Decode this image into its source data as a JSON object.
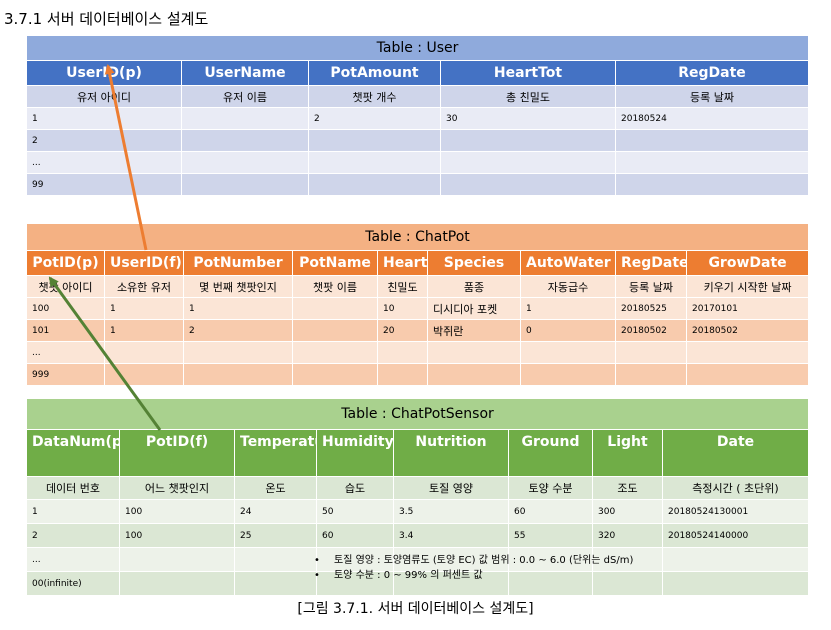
{
  "heading": "3.7.1 서버 데이터베이스 설계도",
  "user_table": {
    "title": "Table : User",
    "columns": [
      "UserID(p)",
      "UserName",
      "PotAmount",
      "HeartTot",
      "RegDate"
    ],
    "descriptions": [
      "유저 아이디",
      "유저 이름",
      "챗팟 개수",
      "총 친밀도",
      "등록 날짜"
    ],
    "rows": [
      [
        "1",
        "",
        "2",
        "30",
        "20180524"
      ],
      [
        "2",
        "",
        "",
        "",
        ""
      ],
      [
        "...",
        "",
        "",
        "",
        ""
      ],
      [
        "99",
        "",
        "",
        "",
        ""
      ]
    ]
  },
  "chatpot_table": {
    "title": "Table : ChatPot",
    "columns": [
      "PotID(p)",
      "UserID(f)",
      "PotNumber",
      "PotName",
      "Heart",
      "Species",
      "AutoWater",
      "RegDate",
      "GrowDate"
    ],
    "descriptions": [
      "챗팟 아이디",
      "소유한 유저",
      "몇 번째 챗팟인지",
      "챗팟 이름",
      "친밀도",
      "품종",
      "자동급수",
      "등록 날짜",
      "키우기 시작한 날짜"
    ],
    "rows": [
      [
        "100",
        "1",
        "1",
        "",
        "10",
        "디시디아 포켓",
        "1",
        "20180525",
        "20170101"
      ],
      [
        "101",
        "1",
        "2",
        "",
        "20",
        "박쥐란",
        "0",
        "20180502",
        "20180502"
      ],
      [
        "...",
        "",
        "",
        "",
        "",
        "",
        "",
        "",
        ""
      ],
      [
        "999",
        "",
        "",
        "",
        "",
        "",
        "",
        "",
        ""
      ]
    ]
  },
  "sensor_table": {
    "title": "Table : ChatPotSensor",
    "columns": [
      "DataNum(p)",
      "PotID(f)",
      "Temperature",
      "Humidity",
      "Nutrition",
      "Ground",
      "Light",
      "Date"
    ],
    "descriptions": [
      "데이터 번호",
      "어느 챗팟인지",
      "온도",
      "습도",
      "토질 영양",
      "토양 수분",
      "조도",
      "측정시간 ( 초단위)"
    ],
    "rows": [
      [
        "1",
        "100",
        "24",
        "50",
        "3.5",
        "60",
        "300",
        "20180524130001"
      ],
      [
        "2",
        "100",
        "25",
        "60",
        "3.4",
        "55",
        "320",
        "20180524140000"
      ],
      [
        "...",
        "",
        "",
        "",
        "",
        "",
        "",
        ""
      ],
      [
        "00(infinite)",
        "",
        "",
        "",
        "",
        "",
        "",
        ""
      ]
    ]
  },
  "notes": [
    "토질 영양 : 토양염류도 (토양 EC) 값 범위 : 0.0 ~ 6.0 (단위는 dS/m)",
    "토양 수분 : 0 ~ 99% 의 퍼센트 값"
  ],
  "caption": "[그림 3.7.1. 서버 데이터베이스 설계도]",
  "colors": {
    "user_header": "#4472c4",
    "chatpot_header": "#ed7d31",
    "sensor_header": "#70ad47",
    "arrow_user": "#ed7d31",
    "arrow_chatpot": "#548235"
  }
}
